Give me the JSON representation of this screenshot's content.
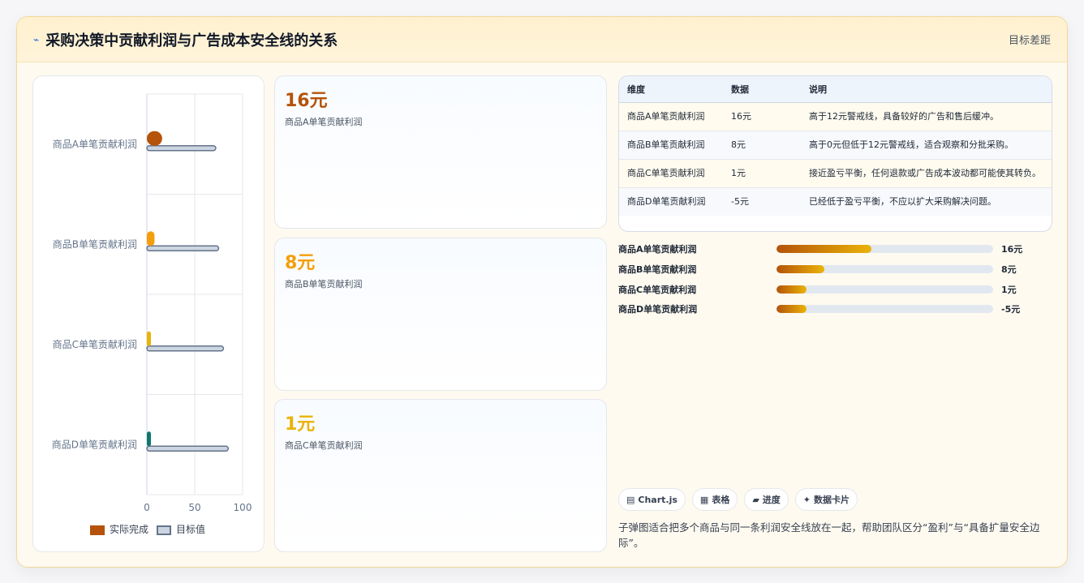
{
  "header": {
    "icon": "sparkle-icon",
    "title": "采购决策中贡献利润与广告成本安全线的关系",
    "right_label": "目标差距"
  },
  "chart_data": {
    "type": "bar",
    "orientation": "horizontal",
    "categories": [
      "商品A单笔贡献利润",
      "商品B单笔贡献利润",
      "商品C单笔贡献利润",
      "商品D单笔贡献利润"
    ],
    "series": [
      {
        "name": "实际完成",
        "values": [
          16,
          8,
          1,
          -5
        ],
        "colors": [
          "#b45309",
          "#f59e0b",
          "#eab308",
          "#0f766e"
        ]
      },
      {
        "name": "目标值",
        "values": [
          72,
          75,
          80,
          85
        ],
        "color": "#cbd5e1",
        "border": "#64748b"
      }
    ],
    "xlim": [
      0,
      100
    ],
    "xticks": [
      "0",
      "50",
      "100"
    ],
    "grid": true,
    "legend": "bottom"
  },
  "kpis": [
    {
      "value": "16元",
      "label": "商品A单笔贡献利润",
      "color": "#b45309"
    },
    {
      "value": "8元",
      "label": "商品B单笔贡献利润",
      "color": "#f59e0b"
    },
    {
      "value": "1元",
      "label": "商品C单笔贡献利润",
      "color": "#eab308"
    }
  ],
  "table": {
    "headers": [
      "维度",
      "数据",
      "说明"
    ],
    "rows": [
      [
        "商品A单笔贡献利润",
        "16元",
        "高于12元警戒线，具备较好的广告和售后缓冲。"
      ],
      [
        "商品B单笔贡献利润",
        "8元",
        "高于0元但低于12元警戒线，适合观察和分批采购。"
      ],
      [
        "商品C单笔贡献利润",
        "1元",
        "接近盈亏平衡，任何退款或广告成本波动都可能使其转负。"
      ],
      [
        "商品D单笔贡献利润",
        "-5元",
        "已经低于盈亏平衡，不应以扩大采购解决问题。"
      ]
    ]
  },
  "progress": [
    {
      "label": "商品A单笔贡献利润",
      "value": "16元",
      "fraction": 0.44
    },
    {
      "label": "商品B单笔贡献利润",
      "value": "8元",
      "fraction": 0.22
    },
    {
      "label": "商品C单笔贡献利润",
      "value": "1元",
      "fraction": 0.14
    },
    {
      "label": "商品D单笔贡献利润",
      "value": "-5元",
      "fraction": 0.14
    }
  ],
  "chips": [
    {
      "icon": "chart-icon",
      "glyph": "▤",
      "label": "Chart.js"
    },
    {
      "icon": "table-icon",
      "glyph": "▦",
      "label": "表格"
    },
    {
      "icon": "progress-icon",
      "glyph": "▰",
      "label": "进度"
    },
    {
      "icon": "card-icon",
      "glyph": "✦",
      "label": "数据卡片"
    }
  ],
  "note": "子弹图适合把多个商品与同一条利润安全线放在一起，帮助团队区分“盈利”与“具备扩量安全边际”。"
}
